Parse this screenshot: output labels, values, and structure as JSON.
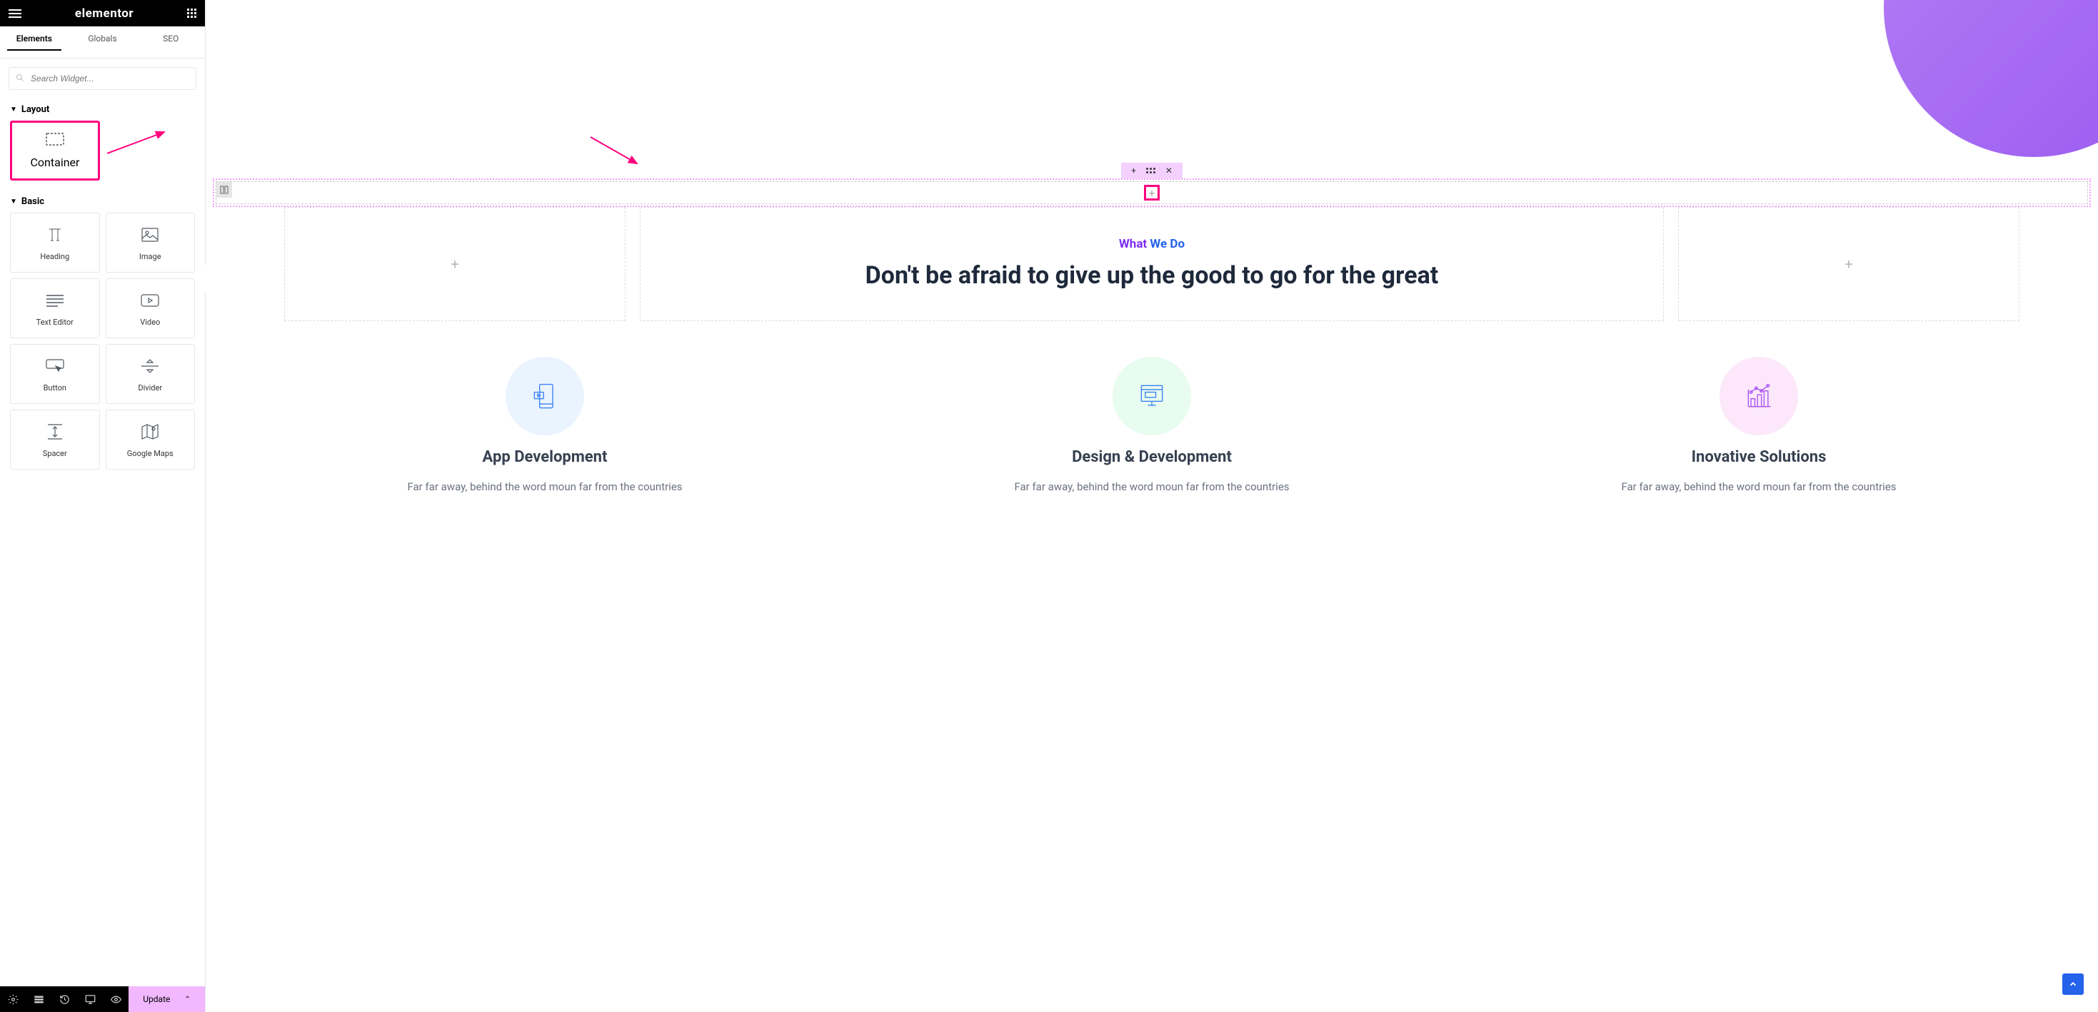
{
  "sidebar": {
    "logo": "elementor",
    "tabs": [
      "Elements",
      "Globals",
      "SEO"
    ],
    "active_tab": 0,
    "search_placeholder": "Search Widget...",
    "sections": {
      "layout": {
        "title": "Layout",
        "widgets": [
          "Container"
        ]
      },
      "basic": {
        "title": "Basic",
        "widgets": [
          "Heading",
          "Image",
          "Text Editor",
          "Video",
          "Button",
          "Divider",
          "Spacer",
          "Google Maps"
        ]
      }
    }
  },
  "footer": {
    "update_label": "Update"
  },
  "canvas": {
    "subtitle_part1": "What ",
    "subtitle_part2": "We Do",
    "hero_title": "Don't be afraid to give up the good to go for the great",
    "services": [
      {
        "title": "App Development",
        "desc": "Far far away, behind the word moun far from the countries",
        "color": "blue"
      },
      {
        "title": "Design & Development",
        "desc": "Far far away, behind the word moun far from the countries",
        "color": "green"
      },
      {
        "title": "Inovative Solutions",
        "desc": "Far far away, behind the word moun far from the countries",
        "color": "pink"
      }
    ]
  },
  "highlights": {
    "container_widget": true,
    "add_button": true
  }
}
